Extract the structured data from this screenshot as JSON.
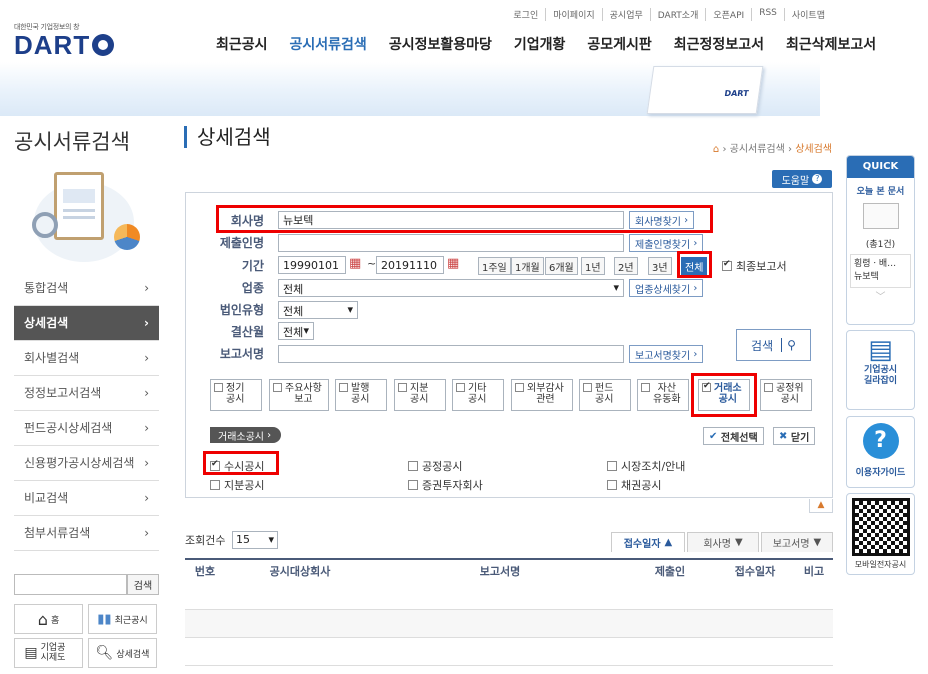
{
  "header": {
    "logo_sub": "대한민국 기업정보의 창",
    "logo_main": "DART",
    "util": [
      "로그인",
      "마이페이지",
      "공시업무",
      "DART소개",
      "오픈API",
      "RSS",
      "사이트맵"
    ],
    "gnb": [
      "최근공시",
      "공시서류검색",
      "공시정보활용마당",
      "기업개황",
      "공모게시판",
      "최근정정보고서",
      "최근삭제보고서"
    ],
    "banner_book_label": "DART"
  },
  "left": {
    "title": "공시서류검색",
    "menu": [
      "통합검색",
      "상세검색",
      "회사별검색",
      "정정보고서검색",
      "펀드공시상세검색",
      "신용평가공시상세검색",
      "비교검색",
      "첨부서류검색"
    ],
    "search_button": "검색",
    "quick": [
      "홈",
      "최근공시",
      "기업공시제도",
      "상세검색"
    ]
  },
  "content": {
    "title": "상세검색",
    "breadcrumb": [
      "공시서류검색",
      "상세검색"
    ],
    "help": "도움말",
    "form": {
      "company_label": "회사명",
      "company_value": "뉴보텍",
      "company_btn": "회사명찾기",
      "submitter_label": "제출인명",
      "submitter_btn": "제출인명찾기",
      "period_label": "기간",
      "date_from": "19990101",
      "date_to": "20191110",
      "periods": [
        "1주일",
        "1개월",
        "6개월",
        "1년",
        "2년",
        "3년",
        "전체"
      ],
      "final_report": "최종보고서",
      "industry_label": "업종",
      "industry_value": "전체",
      "industry_btn": "업종상세찾기",
      "corp_type_label": "법인유형",
      "corp_type_value": "전체",
      "settle_label": "결산월",
      "settle_value": "전체",
      "report_label": "보고서명",
      "report_btn": "보고서명찾기",
      "search_btn": "검색",
      "categories": [
        "정기\n공시",
        "주요사항\n보고",
        "발행\n공시",
        "지분\n공시",
        "기타\n공시",
        "외부감사\n관련",
        "펀드\n공시",
        "자산\n유동화",
        "거래소\n공시",
        "공정위\n공시"
      ],
      "sub_title": "거래소공시",
      "select_all": "전체선택",
      "close": "닫기",
      "subs": [
        "수시공시",
        "공정공시",
        "시장조치/안내",
        "지분공시",
        "증권투자회사",
        "채권공시"
      ]
    },
    "list": {
      "count_label": "조회건수",
      "count_value": "15",
      "sort": [
        "접수일자",
        "회사명",
        "보고서명"
      ],
      "columns": [
        "번호",
        "공시대상회사",
        "보고서명",
        "제출인",
        "접수일자",
        "비고"
      ]
    }
  },
  "right": {
    "quick_title": "QUICK",
    "today_doc": "오늘 본 문서",
    "count": "(총1건)",
    "recent_item": "횡령ㆍ배…",
    "recent_company": "뉴보텍",
    "guide1": "기업공시\n길라잡이",
    "guide2": "이용자가이드",
    "qr": "모바일전자공시"
  },
  "colors": {
    "accent": "#2a6db5",
    "highlight": "#e00000",
    "label": "#4a5a78"
  }
}
